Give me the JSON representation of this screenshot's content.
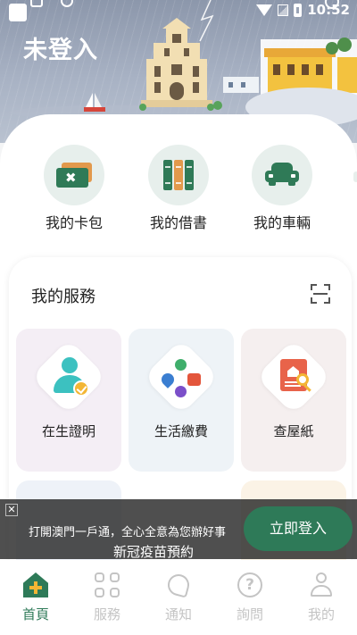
{
  "header": {
    "title": "未登入",
    "status_time": "10:52"
  },
  "quick_access": [
    {
      "label": "我的卡包",
      "icon": "card-wallet-icon"
    },
    {
      "label": "我的借書",
      "icon": "books-icon"
    },
    {
      "label": "我的車輛",
      "icon": "car-icon"
    }
  ],
  "services": {
    "title": "我的服務",
    "edit_icon": "scan-edit-icon",
    "items": [
      {
        "label": "在生證明",
        "icon": "person-check-icon",
        "bg": "#f4eef5"
      },
      {
        "label": "生活繳費",
        "icon": "utilities-icon",
        "bg": "#eef3f7"
      },
      {
        "label": "查屋紙",
        "icon": "property-search-icon",
        "bg": "#f5efef"
      }
    ]
  },
  "login_banner": {
    "line1": "打開澳門一戶通，全心全意為您辦好事",
    "line2": "新冠疫苗預約",
    "button": "立即登入"
  },
  "bottom_nav": [
    {
      "label": "首頁",
      "icon": "home-icon",
      "active": true
    },
    {
      "label": "服務",
      "icon": "grid-icon",
      "active": false
    },
    {
      "label": "通知",
      "icon": "bell-icon",
      "active": false
    },
    {
      "label": "詢問",
      "icon": "question-icon",
      "active": false
    },
    {
      "label": "我的",
      "icon": "user-icon",
      "active": false
    }
  ],
  "colors": {
    "primary_green": "#2e7a58",
    "accent_yellow": "#f3b634",
    "inactive_gray": "#c4c4c4"
  }
}
